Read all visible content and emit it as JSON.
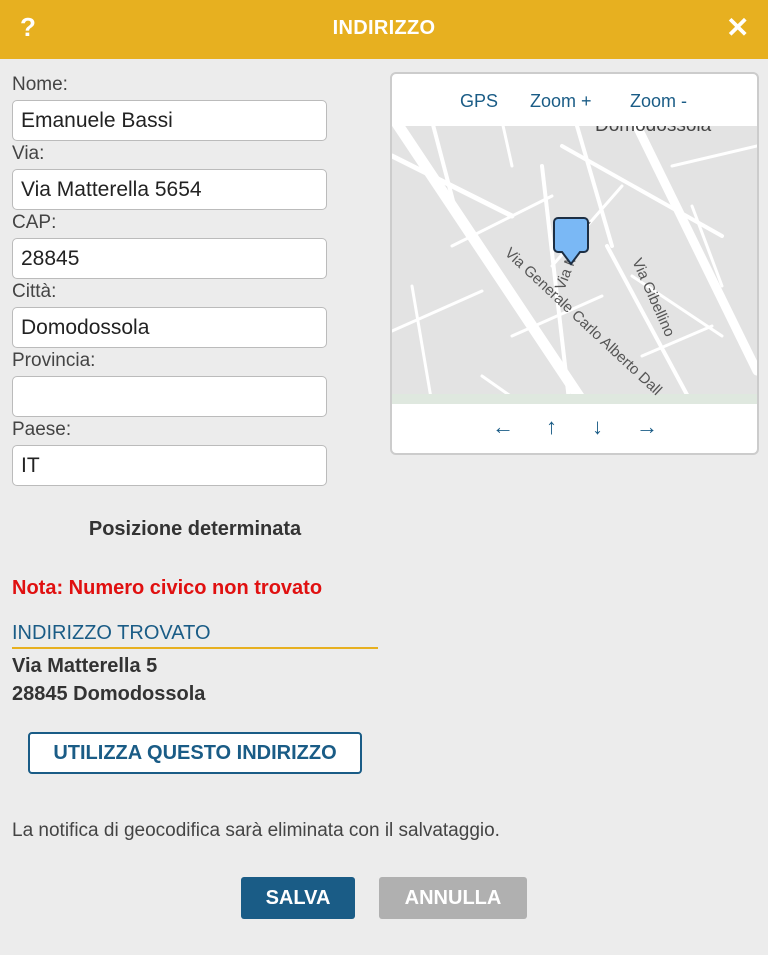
{
  "dialog": {
    "title": "INDIRIZZO",
    "help_label": "?",
    "close_label": "✕"
  },
  "form": {
    "name_label": "Nome:",
    "name_value": "Emanuele Bassi",
    "street_label": "Via:",
    "street_value": "Via Matterella 5654",
    "zip_label": "CAP:",
    "zip_value": "28845",
    "city_label": "Città:",
    "city_value": "Domodossola",
    "province_label": "Provincia:",
    "province_value": "",
    "country_label": "Paese:",
    "country_value": "IT"
  },
  "map": {
    "gps_label": "GPS",
    "zoom_in_label": "Zoom +",
    "zoom_out_label": "Zoom -",
    "nav_left": "←",
    "nav_up": "↑",
    "nav_down": "↓",
    "nav_right": "→",
    "labels": {
      "city": "Domodossola",
      "street_main": "Via Generale Carlo Alberto Dall",
      "street_gibellino": "Via Gibellino",
      "street_matterella": "Via M...ella"
    }
  },
  "status": {
    "position_text": "Posizione determinata",
    "note": "Nota: Numero civico non trovato"
  },
  "found": {
    "heading": "INDIRIZZO TROVATO",
    "line1": "Via Matterella 5",
    "line2": "28845 Domodossola",
    "use_button": "UTILIZZA QUESTO INDIRIZZO"
  },
  "footer": {
    "notice": "La notifica di geocodifica sarà eliminata con il salvataggio.",
    "save_label": "SALVA",
    "cancel_label": "ANNULLA"
  },
  "colors": {
    "header": "#e7b020",
    "primary": "#1a5c86",
    "warning": "#e01010",
    "marker": "#7ab8f5"
  }
}
